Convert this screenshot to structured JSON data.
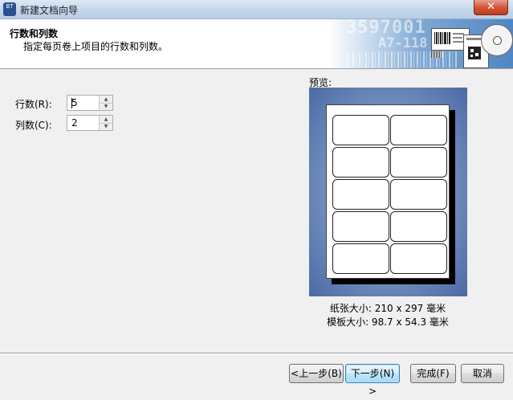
{
  "window": {
    "title": "新建文档向导",
    "close_symbol": "✕",
    "icon_text": "BT"
  },
  "header": {
    "title": "行数和列数",
    "subtitle": "指定每页卷上项目的行数和列数。",
    "banner_text_1": "3597001",
    "banner_text_2": "A7-118"
  },
  "fields": {
    "rows": {
      "label": "行数(R):",
      "value": "5"
    },
    "columns": {
      "label": "列数(C):",
      "value": "2"
    }
  },
  "preview": {
    "label": "预览:",
    "rows": 5,
    "columns": 2,
    "paper_size": "纸张大小: 210 x 297 毫米",
    "template_size": "模板大小: 98.7 x 54.3 毫米"
  },
  "buttons": {
    "back": "<上一步(B)",
    "next": "下一步(N) >",
    "finish": "完成(F)",
    "cancel": "取消"
  },
  "colors": {
    "preview_background": "#6f8fc0",
    "close_button": "#c94a2f",
    "default_button_border": "#3c7fb1"
  }
}
